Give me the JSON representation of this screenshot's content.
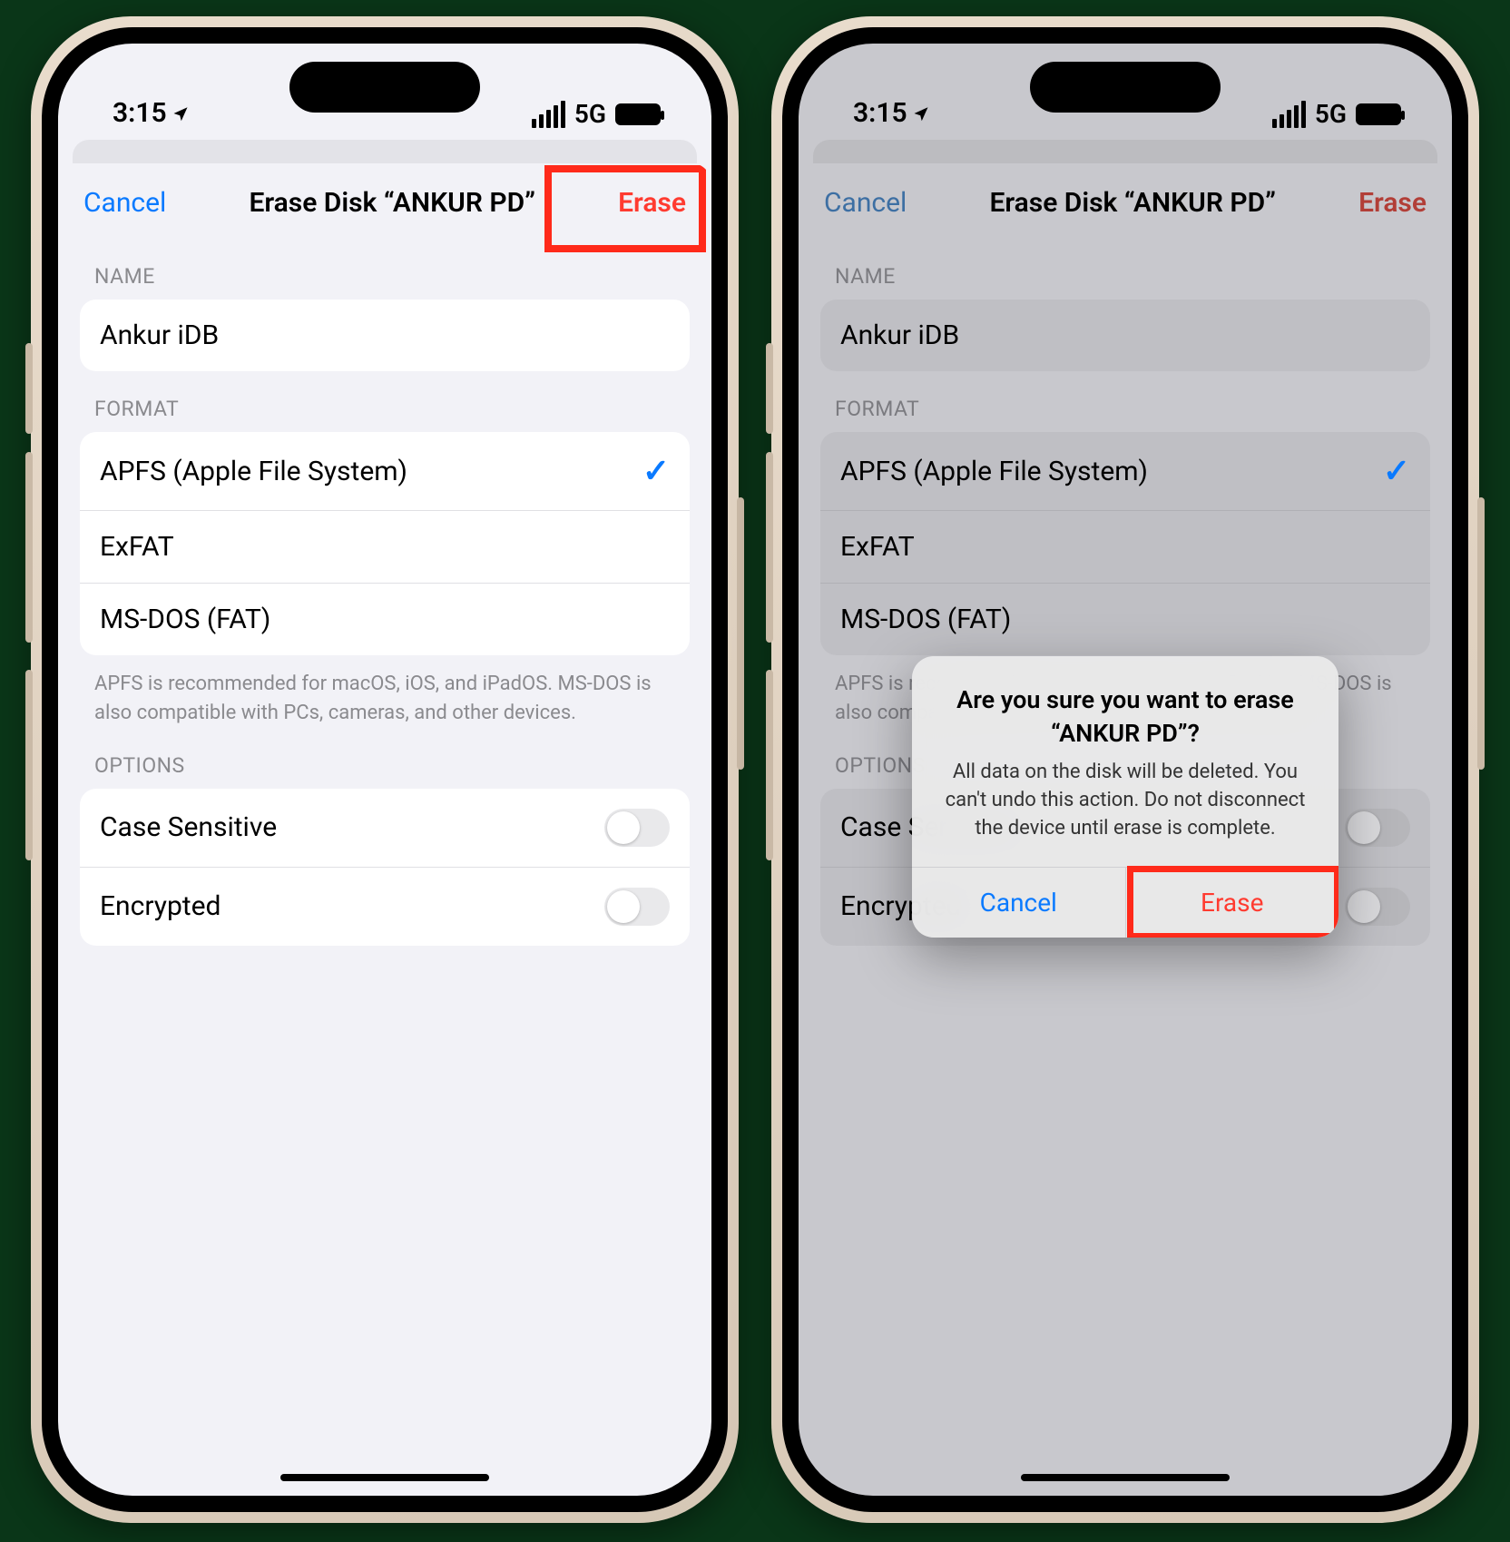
{
  "status": {
    "time": "3:15",
    "network": "5G"
  },
  "nav": {
    "cancel": "Cancel",
    "title": "Erase Disk “ANKUR PD”",
    "erase": "Erase"
  },
  "sections": {
    "name_label": "NAME",
    "name_value": "Ankur iDB",
    "format_label": "FORMAT",
    "formats": [
      {
        "label": "APFS (Apple File System)",
        "selected": true
      },
      {
        "label": "ExFAT",
        "selected": false
      },
      {
        "label": "MS-DOS (FAT)",
        "selected": false
      }
    ],
    "format_footer": "APFS is recommended for macOS, iOS, and iPadOS. MS-DOS is also compatible with PCs, cameras, and other devices.",
    "options_label": "OPTIONS",
    "options": [
      {
        "label": "Case Sensitive",
        "on": false
      },
      {
        "label": "Encrypted",
        "on": false
      }
    ]
  },
  "alert": {
    "title": "Are you sure you want to erase “ANKUR PD”?",
    "message": "All data on the disk will be deleted. You can't undo this action. Do not disconnect the device until erase is complete.",
    "cancel": "Cancel",
    "erase": "Erase"
  }
}
